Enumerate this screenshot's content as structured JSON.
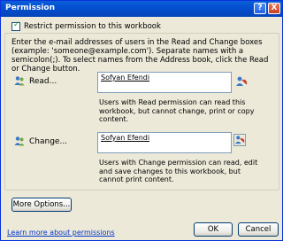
{
  "window": {
    "title": "Permission",
    "help_label": "?",
    "close_label": "X"
  },
  "restrict": {
    "label": "Restrict permission to this workbook",
    "checked": true
  },
  "intro_text": "Enter the e-mail addresses of users in the Read and Change boxes (example: 'someone@example.com'). Separate names with a semicolon(;). To select names from the Address book, click the Read or Change button.",
  "read": {
    "button_label": "Read...",
    "value": "Sofyan Efendi",
    "description": "Users with Read permission can read this workbook, but cannot change, print or copy content."
  },
  "change": {
    "button_label": "Change...",
    "value": "Sofyan Efendi",
    "description": "Users with Change permission can read, edit and save changes to this workbook, but cannot print content."
  },
  "buttons": {
    "more_options": "More Options...",
    "ok": "OK",
    "cancel": "Cancel"
  },
  "footer_link": "Learn more about permissions",
  "colors": {
    "title_bar": "#0a5fd8",
    "dialog_bg": "#ece9d8",
    "link": "#0033cc"
  }
}
